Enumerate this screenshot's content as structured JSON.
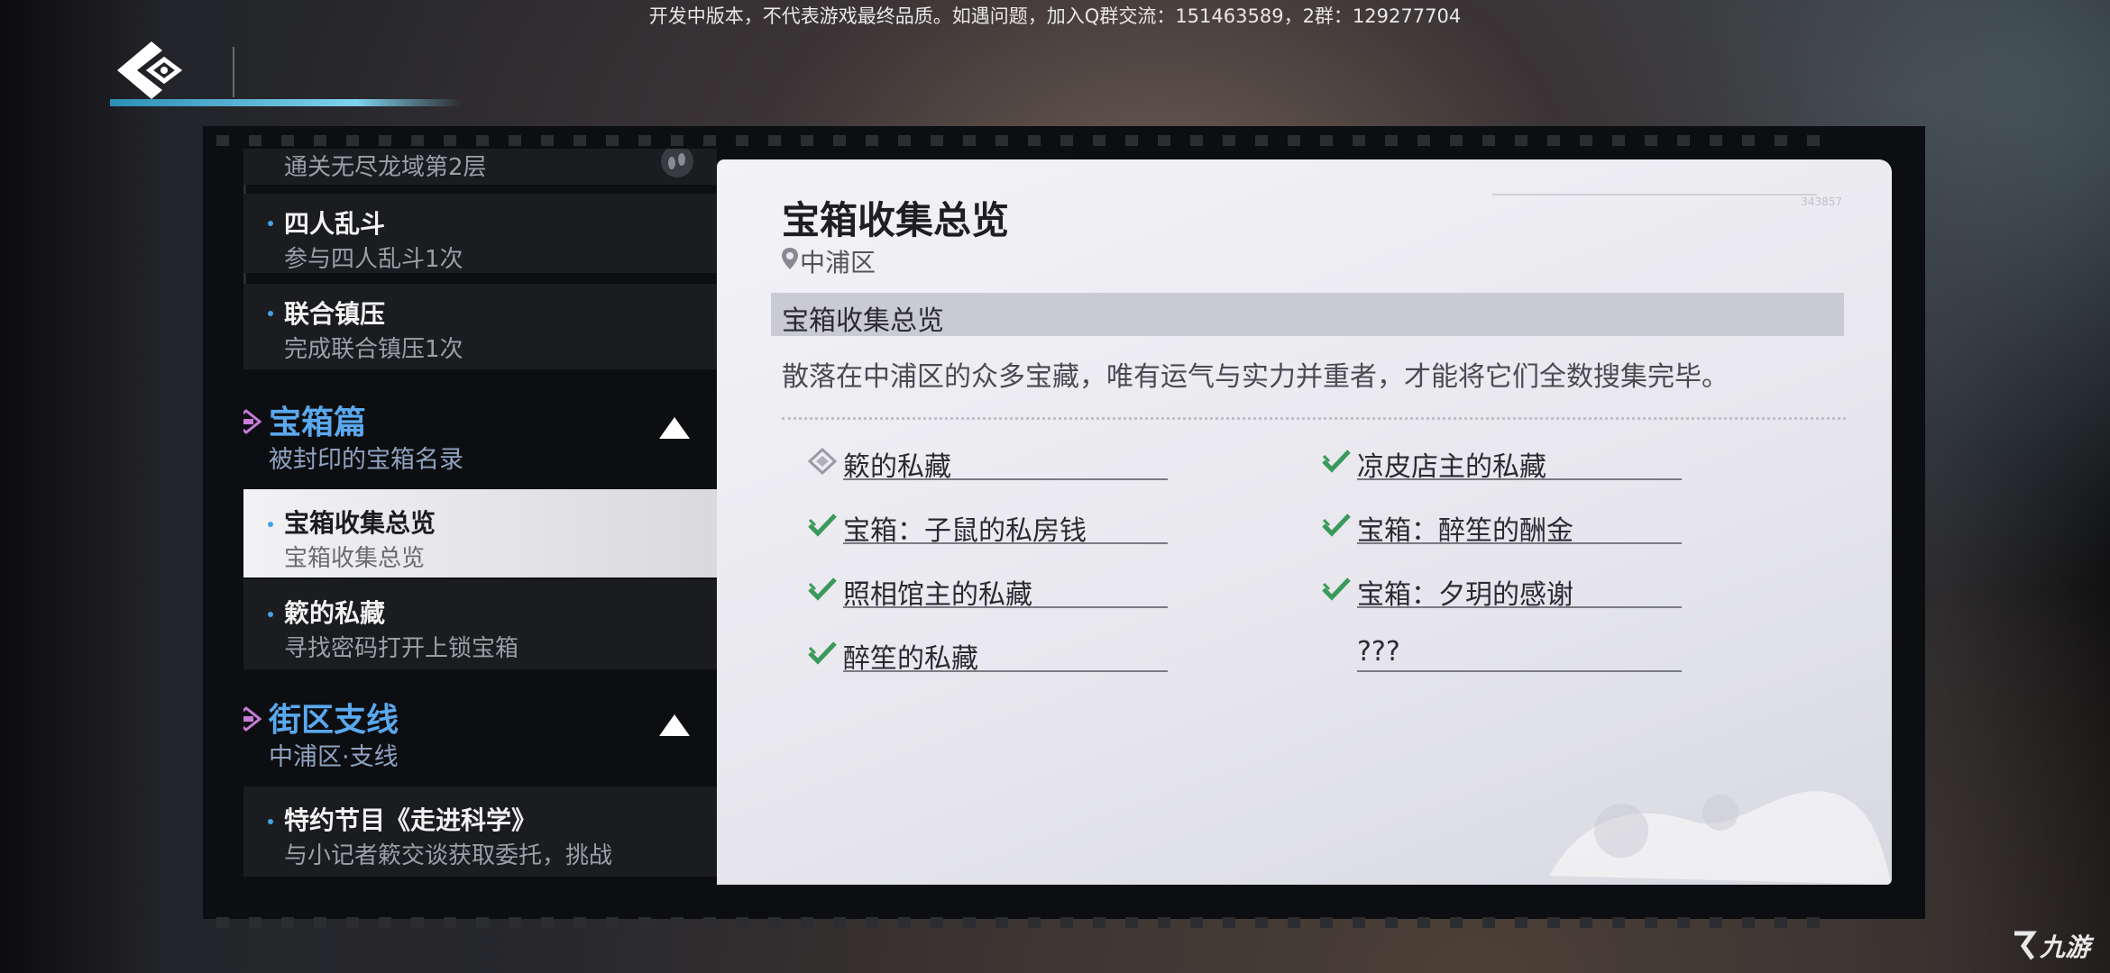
{
  "notice": "开发中版本，不代表游戏最终品质。如遇问题，加入Q群交流：151463589，2群：129277704",
  "colors": {
    "accent_blue": "#5aa8ee",
    "check_green": "#3a9a5a",
    "back_bar": "#7fd3ee"
  },
  "sidebar": {
    "items_top": [
      {
        "subtitle": "通关无尽龙域第2层"
      },
      {
        "title": "四人乱斗",
        "subtitle": "参与四人乱斗1次"
      },
      {
        "title": "联合镇压",
        "subtitle": "完成联合镇压1次"
      }
    ],
    "categories": [
      {
        "title": "宝箱篇",
        "subtitle": "被封印的宝箱名录",
        "items": [
          {
            "title": "宝箱收集总览",
            "subtitle": "宝箱收集总览",
            "selected": true
          },
          {
            "title": "簌的私藏",
            "subtitle": "寻找密码打开上锁宝箱"
          }
        ]
      },
      {
        "title": "街区支线",
        "subtitle": "中浦区·支线",
        "items": [
          {
            "title": "特约节目《走进科学》",
            "subtitle": "与小记者簌交谈获取委托，挑战"
          }
        ]
      }
    ]
  },
  "detail": {
    "title": "宝箱收集总览",
    "location": "中浦区",
    "section_header": "宝箱收集总览",
    "description": "散落在中浦区的众多宝藏，唯有运气与实力并重者，才能将它们全数搜集完毕。",
    "serial": "343857",
    "entries_left": [
      {
        "label": "簌的私藏",
        "status": "incomplete",
        "icon": "diamond-icon"
      },
      {
        "label": "宝箱：子鼠的私房钱",
        "status": "complete",
        "icon": "check-icon"
      },
      {
        "label": "照相馆主的私藏",
        "status": "complete",
        "icon": "check-icon"
      },
      {
        "label": "醉笙的私藏",
        "status": "complete",
        "icon": "check-icon"
      }
    ],
    "entries_right": [
      {
        "label": "凉皮店主的私藏",
        "status": "complete",
        "icon": "check-icon"
      },
      {
        "label": "宝箱：醉笙的酬金",
        "status": "complete",
        "icon": "check-icon"
      },
      {
        "label": "宝箱：夕玥的感谢",
        "status": "complete",
        "icon": "check-icon"
      },
      {
        "label": "???",
        "status": "unknown",
        "icon": ""
      }
    ]
  },
  "watermark": "九游"
}
